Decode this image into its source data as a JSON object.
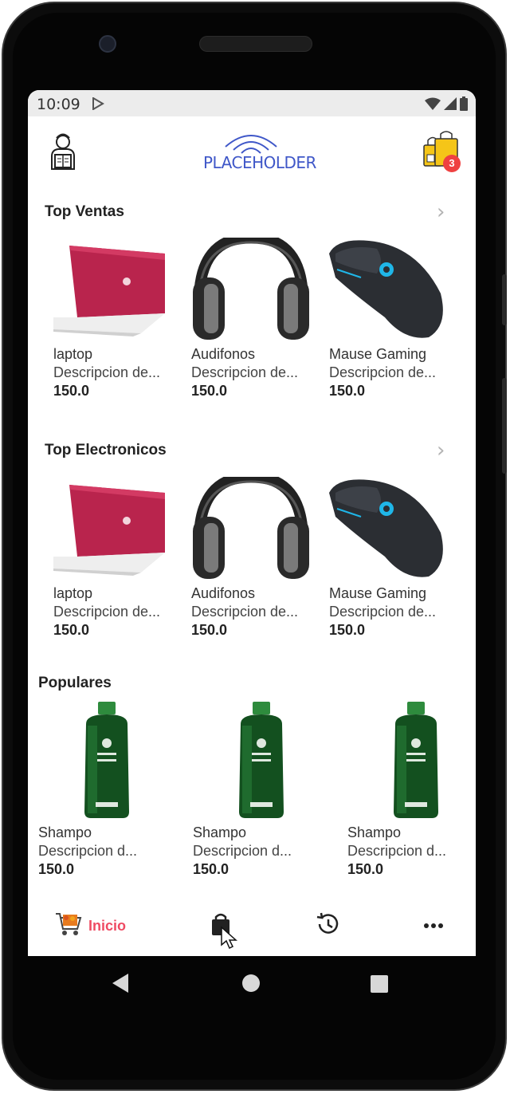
{
  "status_bar": {
    "time": "10:09"
  },
  "app_bar": {
    "logo_text": "PLACEHOLDER",
    "cart_count": "3"
  },
  "sections": [
    {
      "title": "Top Ventas",
      "products": [
        {
          "name": "laptop",
          "description": "Descripcion de...",
          "price": "150.0",
          "image": "laptop"
        },
        {
          "name": "Audifonos",
          "description": "Descripcion de...",
          "price": "150.0",
          "image": "headphones"
        },
        {
          "name": "Mause Gaming",
          "description": "Descripcion de...",
          "price": "150.0",
          "image": "mouse"
        }
      ]
    },
    {
      "title": "Top Electronicos",
      "products": [
        {
          "name": "laptop",
          "description": "Descripcion de...",
          "price": "150.0",
          "image": "laptop"
        },
        {
          "name": "Audifonos",
          "description": "Descripcion de...",
          "price": "150.0",
          "image": "headphones"
        },
        {
          "name": "Mause Gaming",
          "description": "Descripcion de...",
          "price": "150.0",
          "image": "mouse"
        }
      ]
    },
    {
      "title": "Populares",
      "products": [
        {
          "name": "Shampo",
          "description": "Descripcion d...",
          "price": "150.0",
          "image": "shampoo-bottle"
        },
        {
          "name": "Shampo",
          "description": "Descripcion d...",
          "price": "150.0",
          "image": "shampoo-bottle"
        },
        {
          "name": "Shampo",
          "description": "Descripcion d...",
          "price": "150.0",
          "image": "shampoo-bottle"
        }
      ]
    }
  ],
  "bottom_nav": {
    "items": [
      {
        "label": "Inicio",
        "icon": "shopping-cart-icon",
        "active": true
      },
      {
        "icon": "shopping-bag-icon"
      },
      {
        "icon": "history-icon"
      },
      {
        "icon": "more-horizontal-icon"
      }
    ]
  },
  "colors": {
    "accent": "#ef4b63",
    "logo": "#3f57c8",
    "badge": "#ef4141"
  }
}
